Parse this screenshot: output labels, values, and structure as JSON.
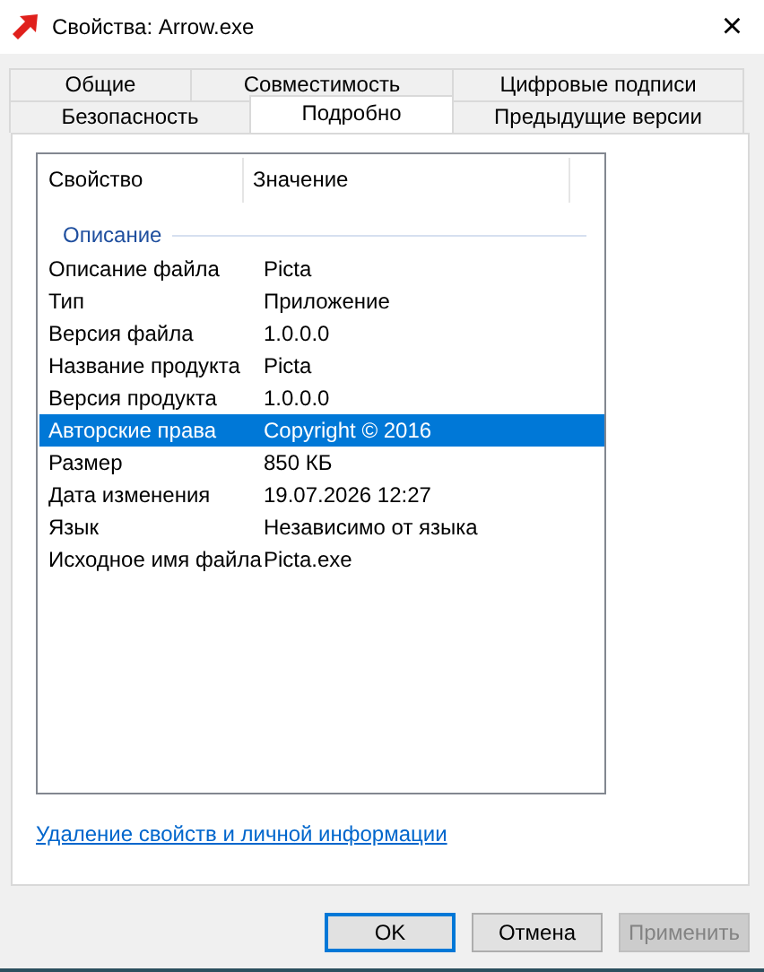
{
  "window": {
    "title": "Свойства: Arrow.exe",
    "close": "×"
  },
  "tab_rows": [
    [
      {
        "label": "Общие",
        "selected": false
      },
      {
        "label": "Совместимость",
        "selected": false
      },
      {
        "label": "Цифровые подписи",
        "selected": false
      }
    ],
    [
      {
        "label": "Безопасность",
        "selected": false
      },
      {
        "label": "Подробно",
        "selected": true
      },
      {
        "label": "Предыдущие версии",
        "selected": false
      }
    ]
  ],
  "table": {
    "columns": [
      "Свойство",
      "Значение"
    ],
    "group": "Описание",
    "rows": [
      {
        "property": "Описание файла",
        "value": "Picta",
        "selected": false
      },
      {
        "property": "Тип",
        "value": "Приложение",
        "selected": false
      },
      {
        "property": "Версия файла",
        "value": "1.0.0.0",
        "selected": false
      },
      {
        "property": "Название продукта",
        "value": "Picta",
        "selected": false
      },
      {
        "property": "Версия продукта",
        "value": "1.0.0.0",
        "selected": false
      },
      {
        "property": "Авторские права",
        "value": "Copyright ©  2016",
        "selected": true
      },
      {
        "property": "Размер",
        "value": "850 КБ",
        "selected": false
      },
      {
        "property": "Дата изменения",
        "value": "19.07.2026 12:27",
        "selected": false
      },
      {
        "property": "Язык",
        "value": "Независимо от языка",
        "selected": false
      },
      {
        "property": "Исходное имя файла",
        "value": "Picta.exe",
        "selected": false
      }
    ]
  },
  "link": "Удаление свойств и личной информации",
  "buttons": [
    {
      "label": "OK",
      "default": true,
      "disabled": false
    },
    {
      "label": "Отмена",
      "default": false,
      "disabled": false
    },
    {
      "label": "Применить",
      "default": false,
      "disabled": true
    }
  ]
}
